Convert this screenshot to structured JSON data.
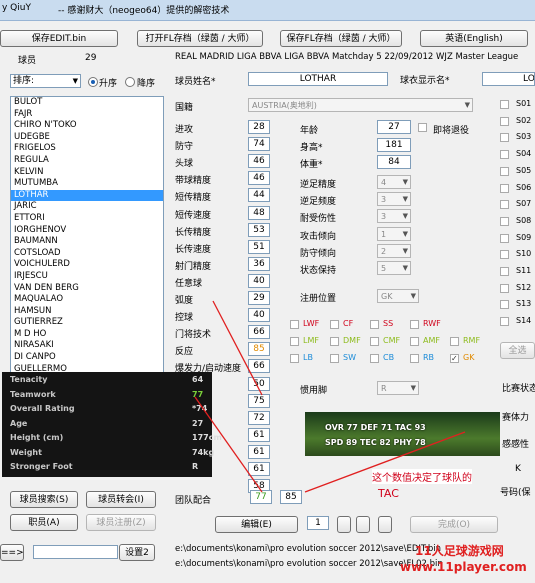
{
  "window": {
    "title_left": "y QiuY",
    "title_main": "-- 感谢财大（neogeo64）提供的解密技术"
  },
  "toolbar": {
    "save_edit": "保存EDIT.bin",
    "open_fl": "打开FL存档（绿茵 / 大师）",
    "save_fl": "保存FL存档（绿茵 / 大师）",
    "language": "英语(English)"
  },
  "league_header": "REAL MADRID LIGA BBVA LIGA BBVA Matchday 5   22/09/2012 WJZ Master League",
  "left": {
    "players_label": "球员",
    "players_count": "29",
    "sort_label": "排序:",
    "sort_asc": "升序",
    "sort_desc": "降序",
    "players": [
      "BULOT",
      "FAJR",
      "CHIRO N'TOKO",
      "UDEGBE",
      "FRIGELOS",
      "REGULA",
      "KELVIN",
      "MUTUMBA",
      "LOTHAR",
      "JARIC",
      "ETTORI",
      "IORGHENOV",
      "BAUMANN",
      "COTSLOAD",
      "VOICHULERD",
      "IRJESCU",
      "VAN DEN BERG",
      "MAQUALAO",
      "HAMSUN",
      "GUTIERREZ",
      "M D HO",
      "NIRASAKI",
      "DI CANPO",
      "GUELLERMO",
      "PALMIERI"
    ],
    "selected_player": "LOTHAR",
    "btn_search": "球员搜索(S)",
    "btn_transfer": "球员转会(I)",
    "btn_position": "职员(A)",
    "btn_disabled": "球员注册(Z)",
    "arrow_btn": "==>",
    "settings_btn": "设置2"
  },
  "player": {
    "name_label": "球员姓名*",
    "name_value": "LOTHAR",
    "shirt_label": "球衣显示名*",
    "shirt_value": "LO",
    "nationality_label": "国籍",
    "nationality_value": "AUSTRIA(奥地利)",
    "stats": [
      {
        "label": "进攻",
        "value": "28"
      },
      {
        "label": "防守",
        "value": "74"
      },
      {
        "label": "头球",
        "value": "46"
      },
      {
        "label": "带球精度",
        "value": "46"
      },
      {
        "label": "短传精度",
        "value": "44"
      },
      {
        "label": "短传速度",
        "value": "48"
      },
      {
        "label": "长传精度",
        "value": "53"
      },
      {
        "label": "长传速度",
        "value": "51"
      },
      {
        "label": "射门精度",
        "value": "36"
      },
      {
        "label": "任意球",
        "value": "40"
      },
      {
        "label": "弧度",
        "value": "29"
      },
      {
        "label": "控球",
        "value": "40"
      },
      {
        "label": "门将技术",
        "value": "66"
      },
      {
        "label": "反应",
        "value": "85"
      },
      {
        "label": "爆发力/启动速度",
        "value": "66"
      }
    ],
    "extra_values": [
      "50",
      "75",
      "72",
      "61",
      "61",
      "61",
      "58"
    ],
    "teamwork_label": "团队配合",
    "teamwork_value": "77",
    "teamwork_edit": "85",
    "age_label": "年龄",
    "age_value": "27",
    "retire_label": "即将退役",
    "height_label": "身高*",
    "height_value": "181",
    "weight_label": "体重*",
    "weight_value": "84",
    "attrs": [
      {
        "label": "逆足精度",
        "value": "4"
      },
      {
        "label": "逆足频度",
        "value": "3"
      },
      {
        "label": "耐受伤性",
        "value": "3"
      },
      {
        "label": "攻击倾向",
        "value": "1"
      },
      {
        "label": "防守倾向",
        "value": "2"
      },
      {
        "label": "状态保持",
        "value": "5"
      }
    ],
    "position_label": "注册位置",
    "position_value": "GK",
    "positions": [
      {
        "label": "LWF",
        "color": "#d0021b"
      },
      {
        "label": "CF",
        "color": "#d0021b"
      },
      {
        "label": "SS",
        "color": "#d0021b"
      },
      {
        "label": "RWF",
        "color": "#d0021b"
      },
      {
        "label": "LMF",
        "color": "#8dbb1c"
      },
      {
        "label": "DMF",
        "color": "#8dbb1c"
      },
      {
        "label": "CMF",
        "color": "#8dbb1c"
      },
      {
        "label": "AMF",
        "color": "#8dbb1c"
      },
      {
        "label": "RMF",
        "color": "#8dbb1c"
      },
      {
        "label": "LB",
        "color": "#1a8bd8"
      },
      {
        "label": "SW",
        "color": "#1a8bd8"
      },
      {
        "label": "CB",
        "color": "#1a8bd8"
      },
      {
        "label": "RB",
        "color": "#1a8bd8"
      },
      {
        "label": "GK",
        "color": "#e08a00"
      }
    ],
    "foot_label": "惯用脚",
    "foot_value": "R"
  },
  "right_side": {
    "slots": [
      "S01",
      "S02",
      "S03",
      "S04",
      "S05",
      "S06",
      "S07",
      "S08",
      "S09",
      "S10",
      "S11",
      "S12",
      "S13",
      "S14"
    ],
    "btn_all": "全选",
    "match_label": "比赛状态",
    "mood_label": "赛体力",
    "feel_label": "感感性",
    "k_label": "K",
    "num_label": "号码(保"
  },
  "overlay": {
    "rows": [
      {
        "label": "Tenacity",
        "value": "64"
      },
      {
        "label": "Teamwork",
        "value": "77"
      },
      {
        "label": "Overall Rating",
        "value": "*74"
      },
      {
        "label": "Age",
        "value": "27"
      },
      {
        "label": "Height (cm)",
        "value": "177cm"
      },
      {
        "label": "Weight",
        "value": "74kg"
      },
      {
        "label": "Stronger Foot",
        "value": "R"
      }
    ]
  },
  "pitch": {
    "line1": "OVR 77  DEF 71  TAC 93",
    "line2": "SPD 89  TEC 82  PHY 78"
  },
  "annotation": {
    "note": "这个数值决定了球队的",
    "tac": "TAC"
  },
  "bottom": {
    "edit_btn": "编辑(E)",
    "page": "1",
    "finish_btn": "完成(O)",
    "path1": "e:\\documents\\konami\\pro evolution soccer 2012\\save\\EDIT.bin",
    "path2": "e:\\documents\\konami\\pro evolution soccer 2012\\save\\FL02.bin"
  },
  "watermark": {
    "cn": "11人足球游戏网",
    "url": "www.11player.com"
  }
}
